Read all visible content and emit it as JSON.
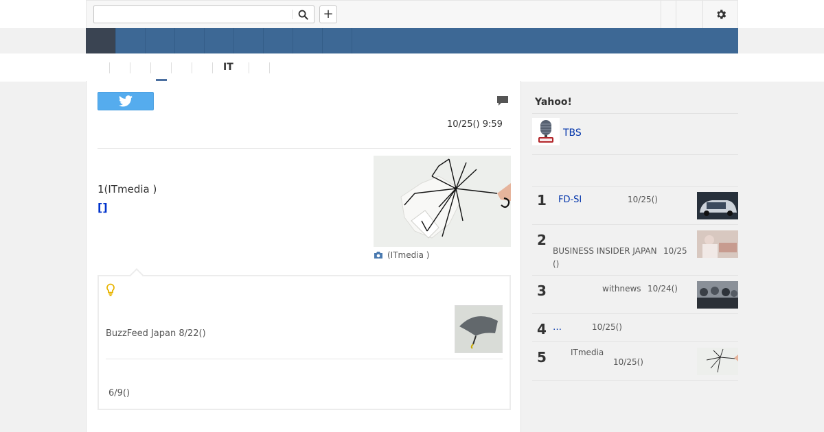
{
  "search": {
    "value": "",
    "placeholder": ""
  },
  "icons": {
    "search": "search-icon",
    "add": "plus-icon",
    "settings": "gear-icon",
    "twitter": "twitter-bird-icon",
    "comment": "comment-icon",
    "camera": "camera-icon",
    "lightbulb": "lightbulb-icon"
  },
  "toolbar": {
    "add_label": "+"
  },
  "category": {
    "active_label": "IT"
  },
  "article": {
    "date": "10/25() 9:59",
    "source": "1(ITmedia )",
    "link_text": "[]",
    "photo_caption": "(ITmedia )"
  },
  "related": {
    "item1": "BuzzFeed Japan 8/22()",
    "item2": "6/9()"
  },
  "sidebar": {
    "title": "Yahoo!",
    "provider": "TBS",
    "ranking": [
      {
        "rank": "1",
        "title": "FD-SI",
        "meta": "10/25()"
      },
      {
        "rank": "2",
        "title": "BUSINESS INSIDER JAPAN",
        "meta": "10/25",
        "meta2": "()"
      },
      {
        "rank": "3",
        "title": "withnews",
        "meta": "10/24()"
      },
      {
        "rank": "4",
        "title": "…",
        "meta": "10/25()"
      },
      {
        "rank": "5",
        "title": "ITmedia",
        "meta": "10/25()"
      }
    ]
  },
  "colors": {
    "nav_blue": "#3d6895",
    "nav_active": "#3a4452",
    "twitter_blue": "#55acee",
    "link_blue": "#0033cc"
  }
}
